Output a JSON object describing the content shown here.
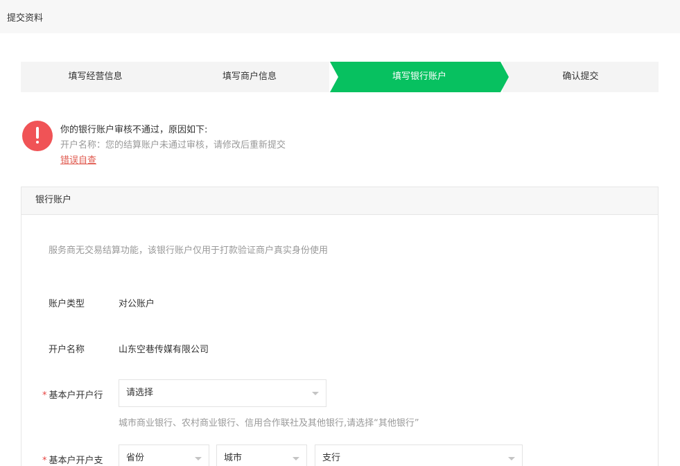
{
  "page": {
    "title": "提交资料"
  },
  "steps": [
    {
      "label": "填写经营信息"
    },
    {
      "label": "填写商户信息"
    },
    {
      "label": "填写银行账户"
    },
    {
      "label": "确认提交"
    }
  ],
  "alert": {
    "title": "你的银行账户审核不通过，原因如下:",
    "description": "开户名称：您的结算账户未通过审核，请修改后重新提交",
    "link": "错误自查"
  },
  "panel": {
    "title": "银行账户",
    "notice": "服务商无交易结算功能，该银行账户仅用于打款验证商户真实身份使用"
  },
  "fields": {
    "account_type": {
      "label": "账户类型",
      "value": "对公账户"
    },
    "account_name": {
      "label": "开户名称",
      "value": "山东空巷传媒有限公司"
    },
    "bank": {
      "required_mark": "*",
      "label": "基本户开户行",
      "placeholder": "请选择",
      "hint": "城市商业银行、农村商业银行、信用合作联社及其他银行,请选择“其他银行”"
    },
    "branch": {
      "required_mark": "*",
      "label": "基本户开户支",
      "province": "省份",
      "city": "城市",
      "sub_branch": "支行"
    }
  },
  "colors": {
    "accent_green": "#07c160",
    "error_red": "#f05356"
  }
}
